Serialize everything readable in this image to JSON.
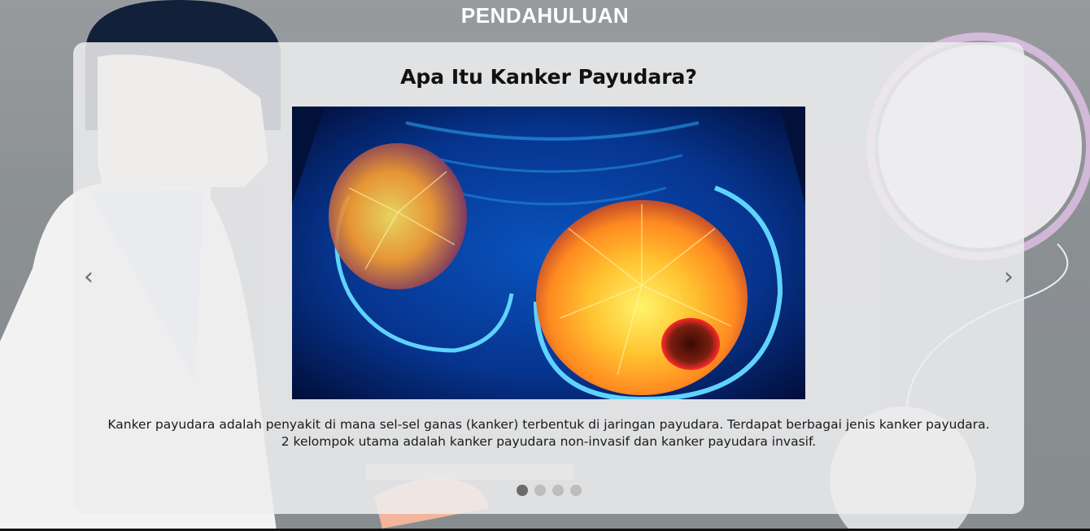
{
  "page": {
    "section_title": "PENDAHULUAN"
  },
  "slide": {
    "title": "Apa Itu Kanker Payudara?",
    "image_alt": "Ilustrasi anatomi payudara dengan tumor",
    "text": "Kanker payudara adalah penyakit di mana sel-sel ganas (kanker) terbentuk di jaringan payudara. Terdapat berbagai jenis kanker payudara. 2 kelompok utama adalah kanker payudara non-invasif dan kanker payudara invasif."
  },
  "carousel": {
    "prev_label": "‹",
    "next_label": "›",
    "slide_count": 4,
    "active_index": 0
  },
  "colors": {
    "background": "#8e9396",
    "card": "#edeeef",
    "title_text": "#ffffff",
    "dot_active": "#6b6b6b",
    "dot_inactive": "#bdbdbd"
  }
}
